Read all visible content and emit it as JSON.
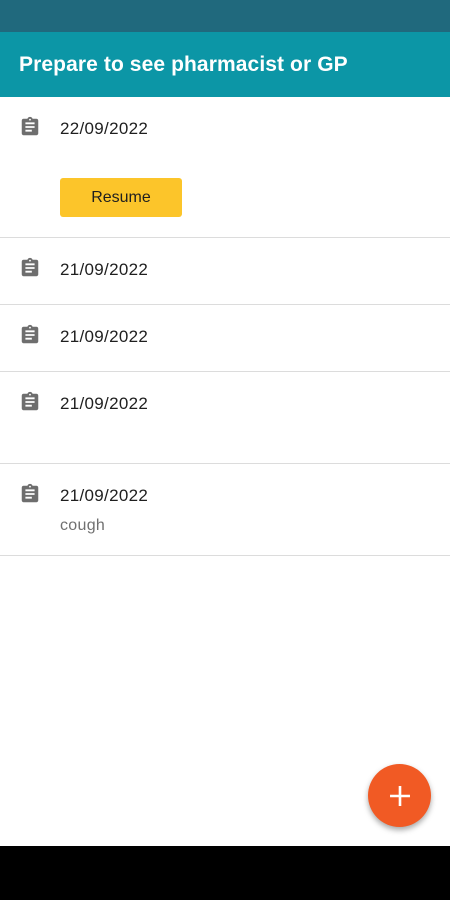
{
  "app": {
    "title": "Prepare to see pharmacist or GP",
    "header_color": "#0c96a6",
    "status_bar_color": "#20697d"
  },
  "consultations": [
    {
      "date": "22/09/2022",
      "note": "",
      "action_label": "Resume",
      "icon": "clipboard-icon"
    },
    {
      "date": "21/09/2022",
      "note": "",
      "icon": "clipboard-icon"
    },
    {
      "date": "21/09/2022",
      "note": "",
      "icon": "clipboard-icon"
    },
    {
      "date": "21/09/2022",
      "note": "",
      "icon": "clipboard-icon"
    },
    {
      "date": "21/09/2022",
      "note": "cough",
      "icon": "clipboard-icon"
    }
  ],
  "fab": {
    "icon": "plus-icon",
    "color": "#f15a24"
  },
  "resume_button_color": "#fcc52a"
}
